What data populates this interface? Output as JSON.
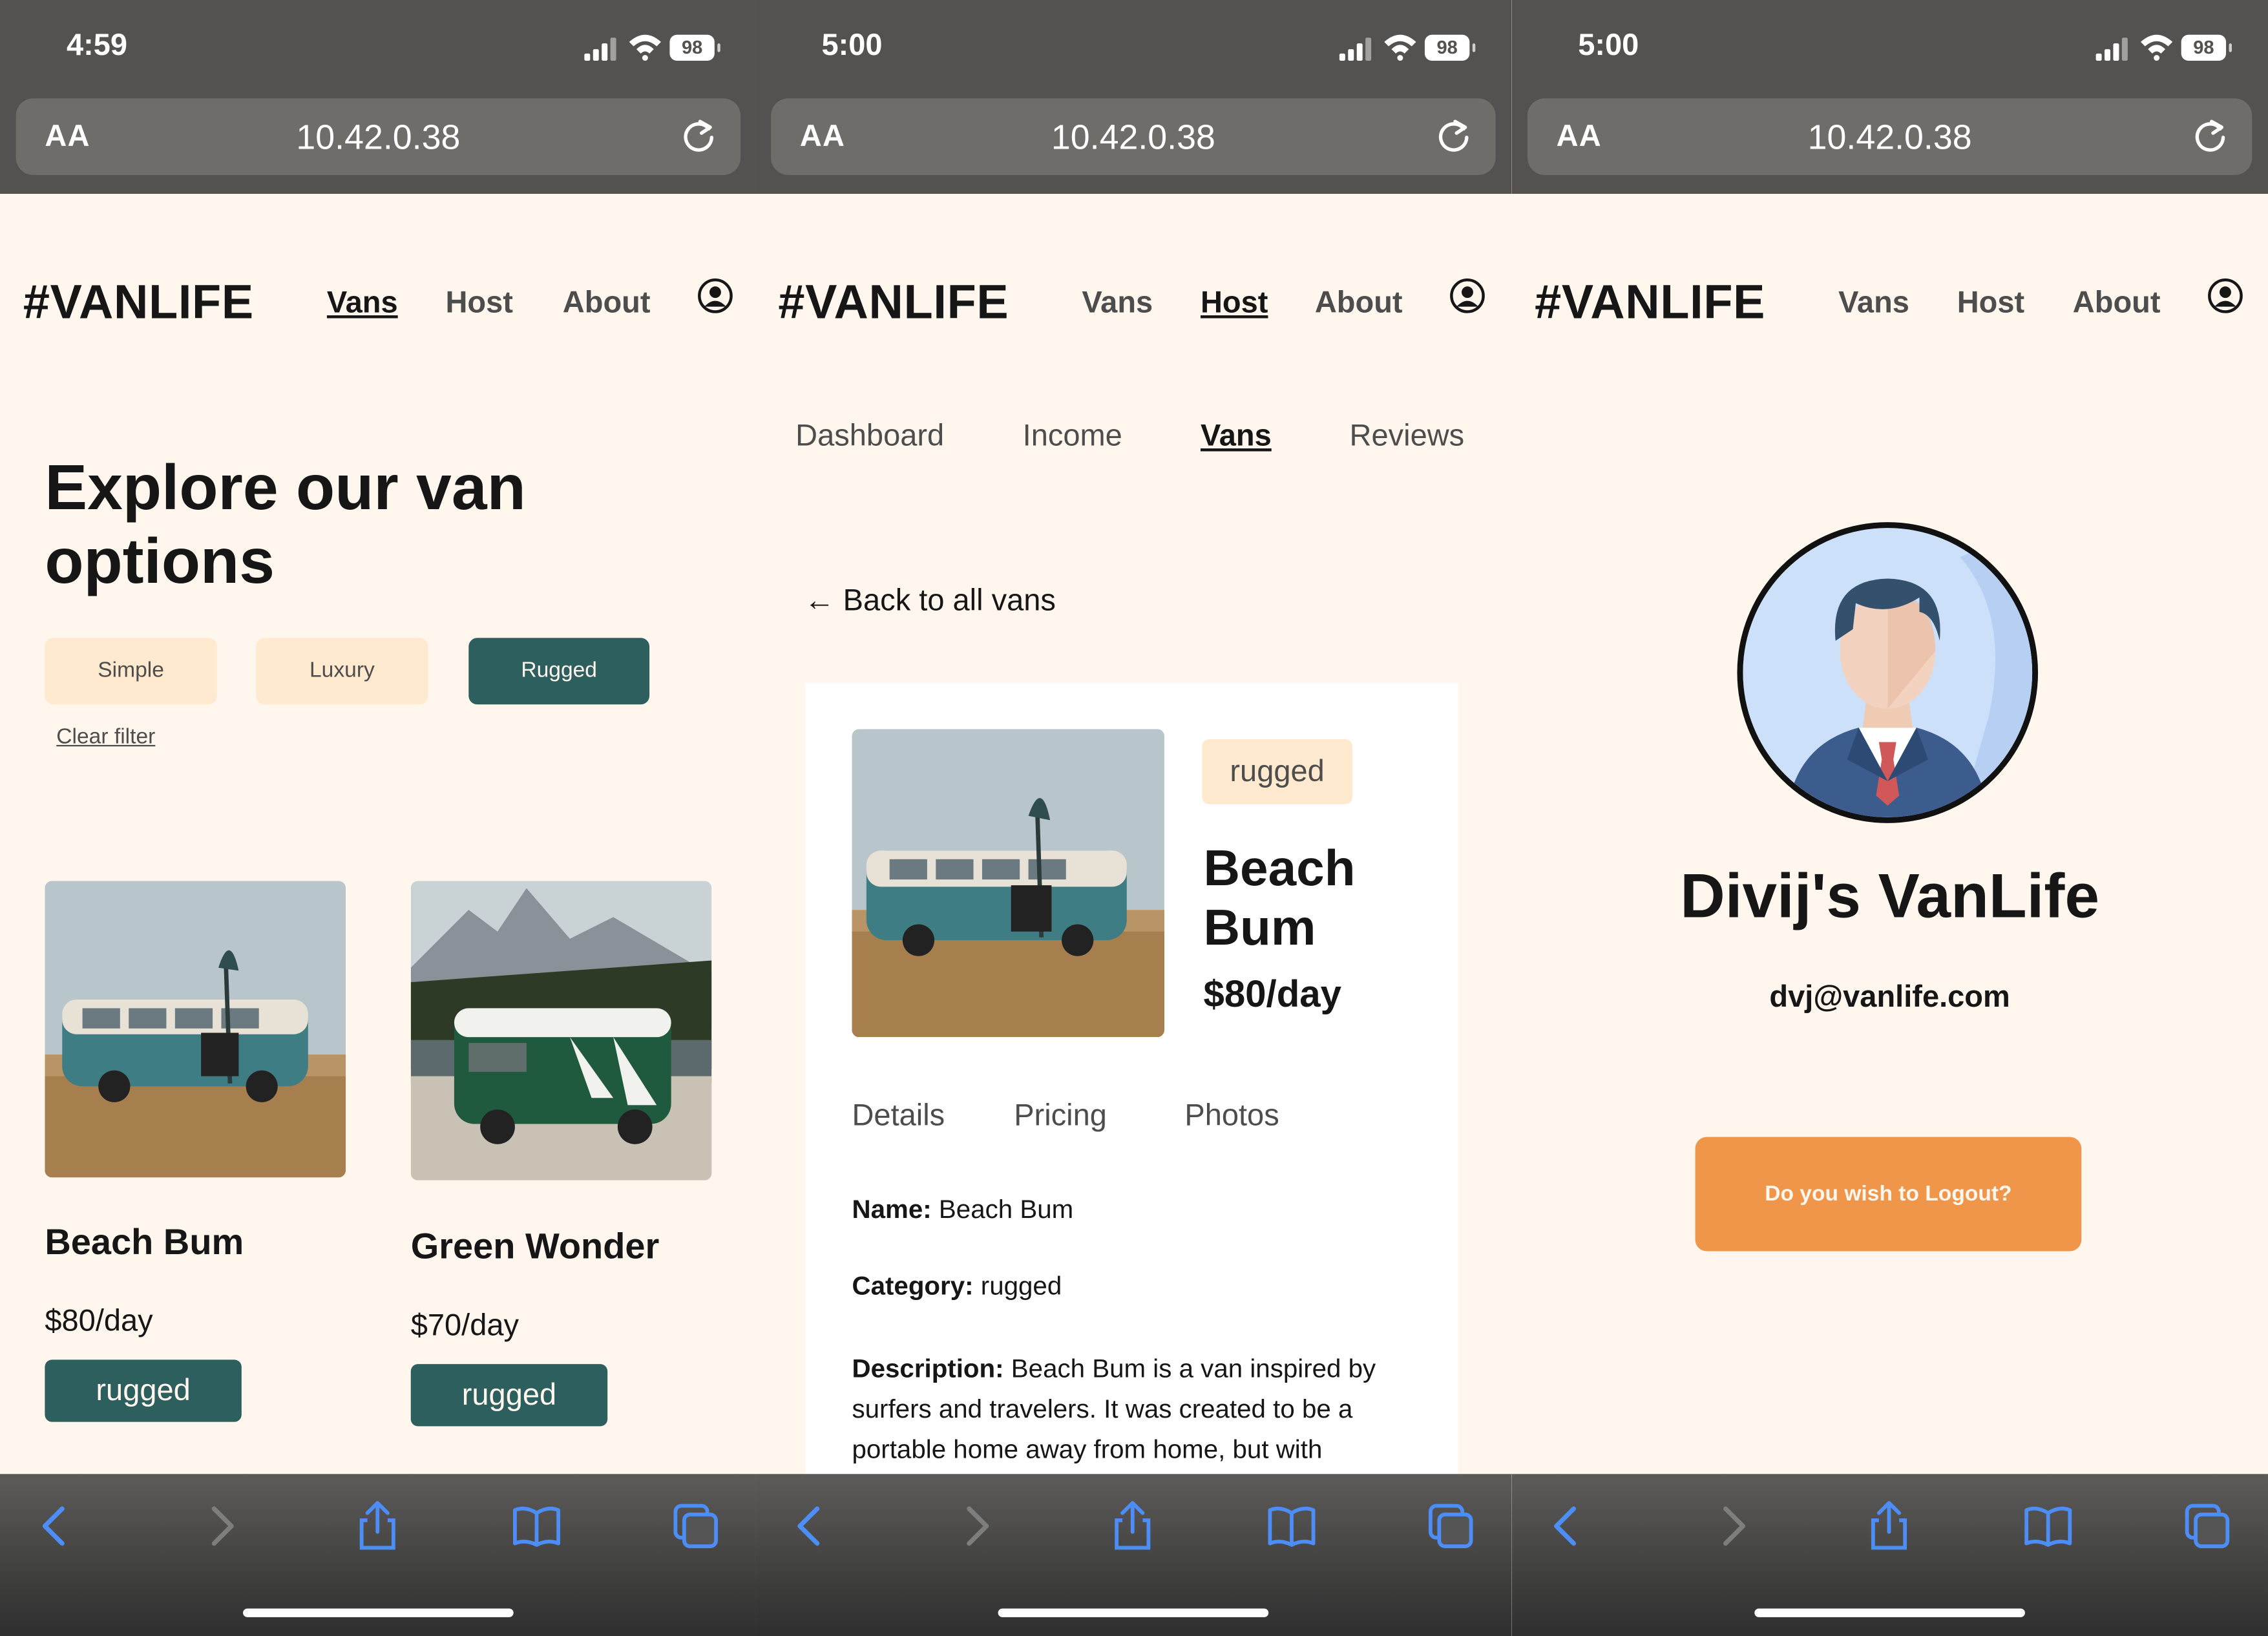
{
  "colors": {
    "page_bg": "#fff7ed",
    "chrome_gray": "#545250",
    "urlbar_gray": "#6f6d6a",
    "accent_teal": "#2c5f5d",
    "chip_beige": "#ffead0",
    "logout_orange": "#f0964a",
    "ios_blue": "#4c8df6"
  },
  "browser": {
    "aa_label": "AA",
    "url": "10.42.0.38",
    "battery": "98",
    "reload_icon": "reload-icon",
    "toolbar_icons": [
      "back-arrow-icon",
      "forward-arrow-icon",
      "share-icon",
      "bookmarks-icon",
      "tabs-icon"
    ]
  },
  "nav": {
    "logo": "#VANLIFE",
    "vans": "Vans",
    "host": "Host",
    "about": "About",
    "account_icon": "user-circle-icon"
  },
  "screen1": {
    "time": "4:59",
    "active_nav": "Vans",
    "heading": "Explore our van options",
    "filters": [
      "Simple",
      "Luxury",
      "Rugged"
    ],
    "selected_filter": "Rugged",
    "clear_filter": "Clear filter",
    "vans": [
      {
        "name": "Beach Bum",
        "price": "$80/day",
        "type": "rugged"
      },
      {
        "name": "Green Wonder",
        "price": "$70/day",
        "type": "rugged"
      }
    ]
  },
  "screen2": {
    "time": "5:00",
    "active_nav": "Host",
    "subnav": [
      "Dashboard",
      "Income",
      "Vans",
      "Reviews"
    ],
    "active_subnav": "Vans",
    "back_link": "← Back to all vans",
    "van": {
      "type": "rugged",
      "name": "Beach Bum",
      "price": "$80/day"
    },
    "tabs": [
      "Details",
      "Pricing",
      "Photos"
    ],
    "details": {
      "name_label": "Name:",
      "name_value": "Beach Bum",
      "category_label": "Category:",
      "category_value": "rugged",
      "description_label": "Description:",
      "description_value": "Beach Bum is a van inspired by surfers and travelers. It was created to be a portable home away from home, but with"
    }
  },
  "screen3": {
    "time": "5:00",
    "profile_name": "Divij's VanLife",
    "email": "dvj@vanlife.com",
    "logout_label": "Do you wish to Logout?"
  }
}
